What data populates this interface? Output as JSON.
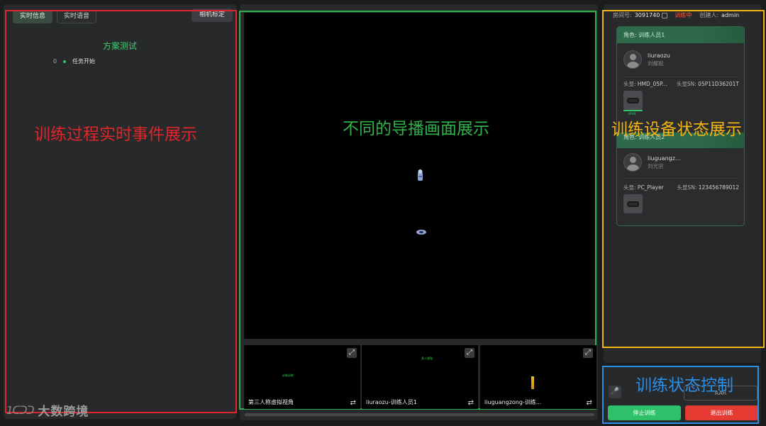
{
  "left_panel": {
    "tabs": [
      "实时信息",
      "实时语音"
    ],
    "calibrate_label": "相机标定",
    "plan_title": "方案测试",
    "events": [
      {
        "index": "0",
        "text": "任务开始"
      }
    ],
    "annotation": "训练过程实时事件展示"
  },
  "center_panel": {
    "annotation": "不同的导播画面展示",
    "thumbs": [
      {
        "label": "第三人称虚拟视角",
        "mini": "训练训练"
      },
      {
        "label": "liuraozu-训练人员1",
        "mini": "多人视角"
      },
      {
        "label": "liuguangzong-训练..."
      }
    ],
    "expand_glyph": "⤢",
    "swap_glyph": "⇄"
  },
  "right_panel": {
    "room_label": "房间号:",
    "room_number": "3091740",
    "status": "训练中",
    "creator_label": "创建人:",
    "creator": "admin",
    "annotation": "训练设备状态展示",
    "members": [
      {
        "role": "角色: 训练人员1",
        "user_id": "liuraozu",
        "user_name": "刘耀祖",
        "hmd_label": "头显:",
        "hmd_value": "HMD_05P...",
        "sn_label": "头显SN:",
        "sn_value": "05P11D36201T",
        "tile_caption": "MAIN"
      },
      {
        "role": "角色: 训练人员2",
        "user_id": "liuguangz...",
        "user_name": "刘光宗",
        "hmd_label": "头显:",
        "hmd_value": "PC_Player",
        "sn_label": "头显SN:",
        "sn_value": "123456789012"
      }
    ]
  },
  "control_panel": {
    "annotation": "训练状态控制",
    "aar_label": "AAR",
    "stop_label": "停止训练",
    "exit_label": "退出训练",
    "mic_glyph": "🎤"
  },
  "brand": {
    "mark": "1ᑕᑐᑐ",
    "text": "大数跨境"
  },
  "colors": {
    "accent_green": "#2ec16a",
    "danger_red": "#e63b32",
    "annot_red": "#e0252b",
    "annot_green": "#2fb24a",
    "annot_yellow": "#f2b512",
    "annot_blue": "#2b8fe8"
  }
}
